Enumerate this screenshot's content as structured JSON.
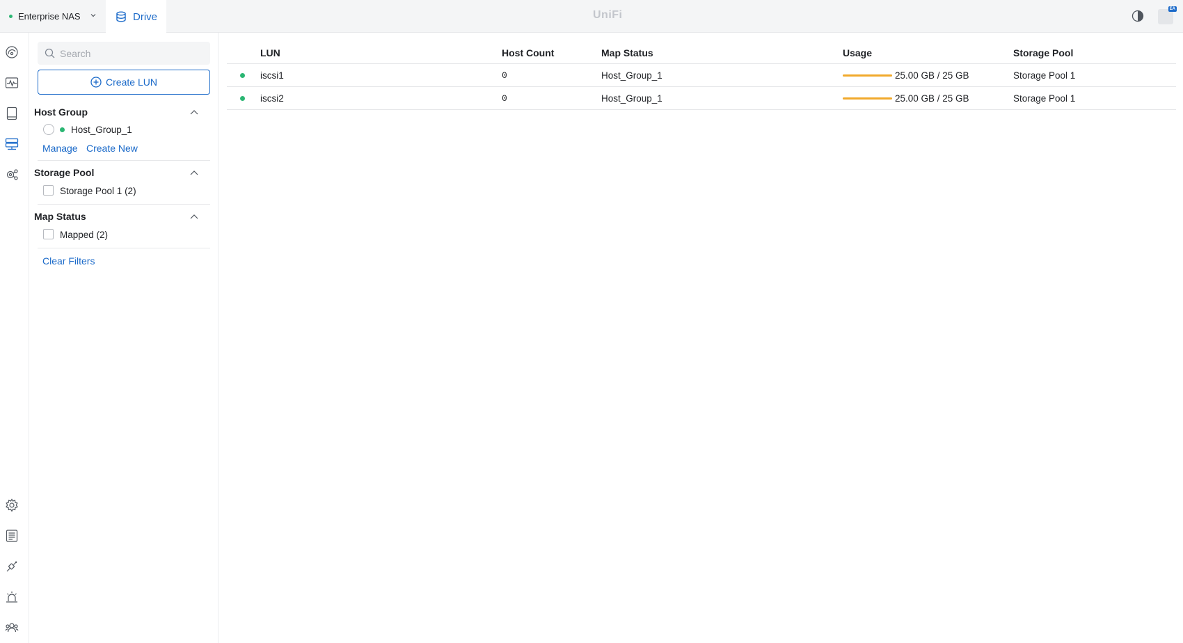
{
  "topbar": {
    "console_name": "Enterprise NAS",
    "app_name": "Drive",
    "brand": "UniFi",
    "avatar_badge": "EA"
  },
  "rail": {
    "top_icons": [
      "dashboard-icon",
      "activity-icon",
      "drives-icon",
      "storage-icon",
      "network-settings-icon"
    ],
    "bottom_icons": [
      "settings-icon",
      "logs-icon",
      "integrations-icon",
      "alerts-icon",
      "users-icon"
    ]
  },
  "filters": {
    "search_placeholder": "Search",
    "create_label": "Create LUN",
    "host_group": {
      "title": "Host Group",
      "options": [
        "Host_Group_1"
      ],
      "manage_label": "Manage",
      "create_new_label": "Create New"
    },
    "storage_pool": {
      "title": "Storage Pool",
      "options": [
        "Storage Pool 1 (2)"
      ]
    },
    "map_status": {
      "title": "Map Status",
      "options": [
        "Mapped (2)"
      ]
    },
    "clear_label": "Clear Filters"
  },
  "table": {
    "headers": {
      "lun": "LUN",
      "host_count": "Host Count",
      "map_status": "Map Status",
      "usage": "Usage",
      "storage_pool": "Storage Pool"
    },
    "rows": [
      {
        "lun": "iscsi1",
        "host_count": "0",
        "map_status": "Host_Group_1",
        "usage_text": "25.00 GB / 25 GB",
        "usage_fraction": 1.0,
        "storage_pool": "Storage Pool 1"
      },
      {
        "lun": "iscsi2",
        "host_count": "0",
        "map_status": "Host_Group_1",
        "usage_text": "25.00 GB / 25 GB",
        "usage_fraction": 1.0,
        "storage_pool": "Storage Pool 1"
      }
    ]
  },
  "colors": {
    "accent": "#1b6ac9",
    "online": "#2bb673",
    "usage_bar": "#f1a92b"
  }
}
